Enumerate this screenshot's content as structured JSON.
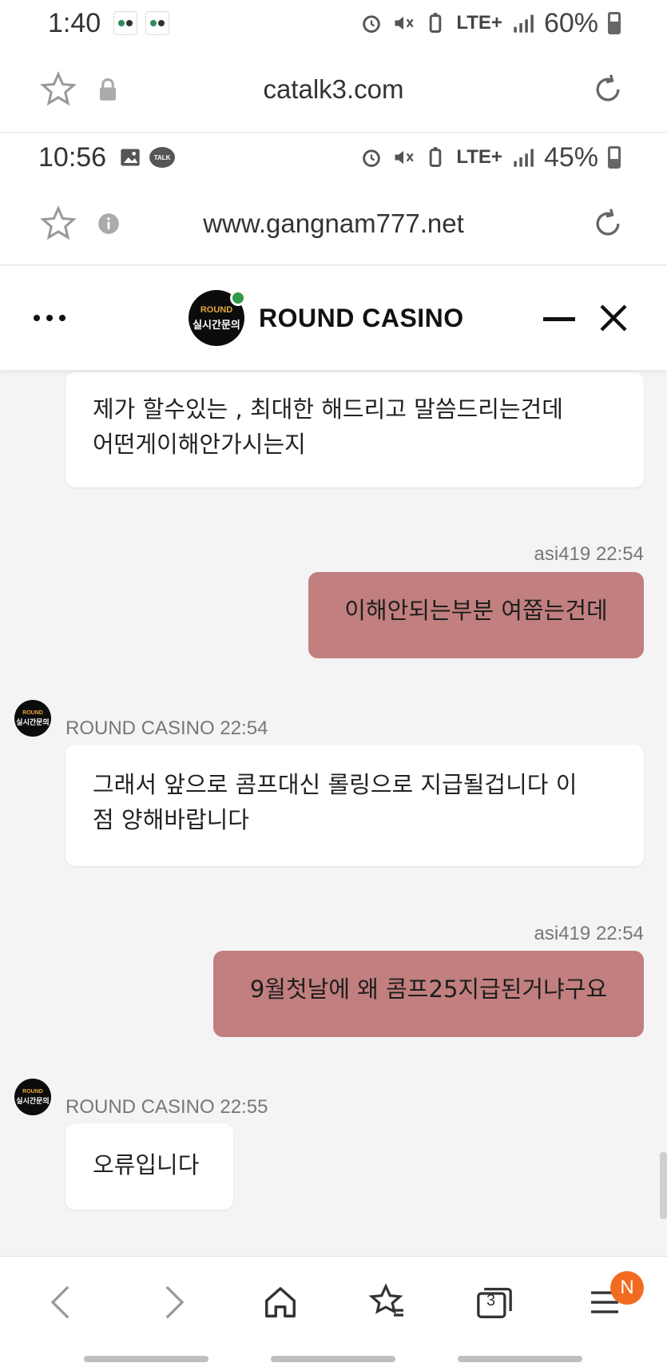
{
  "outer_status": {
    "time": "1:40",
    "battery": "60%",
    "network": "LTE+"
  },
  "outer_browser": {
    "url": "catalk3.com"
  },
  "inner_status": {
    "time": "10:56",
    "battery": "45%",
    "network": "LTE+",
    "talk_label": "TALK"
  },
  "inner_browser": {
    "url": "www.gangnam777.net"
  },
  "chat_header": {
    "title": "ROUND CASINO",
    "logo_line1": "ROUND",
    "logo_line2": "실시간문의"
  },
  "messages": [
    {
      "side": "in",
      "lines": [
        "제가 할수있는 , 최대한 해드리고 말씀드리는건데",
        "어떤게이해안가시는지"
      ]
    },
    {
      "side": "out",
      "sender": "asi419",
      "time": "22:54",
      "text": "이해안되는부분 여쭙는건데"
    },
    {
      "side": "in",
      "sender": "ROUND CASINO",
      "time": "22:54",
      "lines": [
        "그래서 앞으로 콤프대신 롤링으로 지급될겁니다 이",
        "점 양해바랍니다"
      ]
    },
    {
      "side": "out",
      "sender": "asi419",
      "time": "22:54",
      "text": "9월첫날에 왜 콤프25지급된거냐구요"
    },
    {
      "side": "in",
      "sender": "ROUND CASINO",
      "time": "22:55",
      "lines": [
        "오류입니다"
      ]
    }
  ],
  "bottom_nav": {
    "tabs_count": "3",
    "menu_badge": "N"
  },
  "colors": {
    "outgoing_bubble": "#c27f7f",
    "incoming_bubble": "#ffffff",
    "online_dot": "#2e9a4a",
    "badge": "#f26b21"
  }
}
